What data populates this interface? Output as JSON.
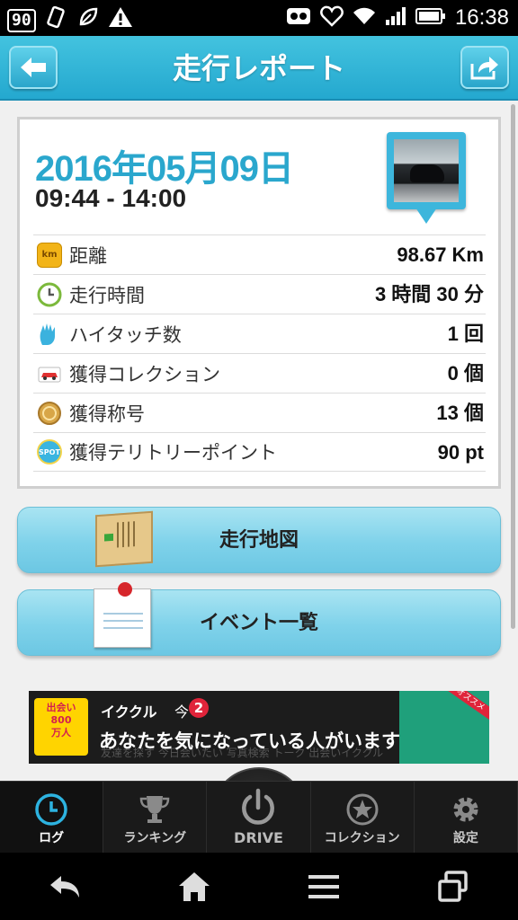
{
  "status_bar": {
    "battery_level": "90",
    "icons": [
      "sim-card-icon",
      "vibrate-icon",
      "leaf-icon",
      "warning-icon",
      "voicemail-icon",
      "heart-icon",
      "wifi-icon",
      "signal-icon",
      "battery-icon"
    ],
    "time": "16:38"
  },
  "header": {
    "title": "走行レポート",
    "back_icon": "back-arrow-icon",
    "share_icon": "share-icon"
  },
  "report": {
    "date": "2016年05月09日",
    "time_range": "09:44 - 14:00",
    "rows": [
      {
        "icon": "km-icon",
        "icon_text": "km",
        "label": "距離",
        "value": "98.67 Km"
      },
      {
        "icon": "clock-icon",
        "label": "走行時間",
        "value": "3 時間 30 分"
      },
      {
        "icon": "high-touch-icon",
        "label": "ハイタッチ数",
        "value": "1 回"
      },
      {
        "icon": "car-icon",
        "label": "獲得コレクション",
        "value": "0 個"
      },
      {
        "icon": "medal-icon",
        "label": "獲得称号",
        "value": "13 個"
      },
      {
        "icon": "spot-icon",
        "icon_text": "SPOT",
        "label": "獲得テリトリーポイント",
        "value": "90 pt"
      }
    ]
  },
  "actions": {
    "map_label": "走行地図",
    "events_label": "イベント一覧"
  },
  "ad": {
    "logo_text": "出会い\n800\n万人",
    "brand": "イククル",
    "today": "今",
    "count": "2",
    "headline": "あなたを気になっている人がいます",
    "background_labels": "友達を探す  今日会いたい  写真検索  トーク  出会いイククル",
    "ribbon": "オススメ"
  },
  "tabs": [
    {
      "label": "ログ",
      "icon": "log-clock-icon",
      "active": true
    },
    {
      "label": "ランキング",
      "icon": "trophy-icon",
      "active": false
    },
    {
      "label": "DRIVE",
      "icon": "power-icon",
      "active": false
    },
    {
      "label": "コレクション",
      "icon": "star-icon",
      "active": false
    },
    {
      "label": "設定",
      "icon": "gear-icon",
      "active": false
    }
  ],
  "colors": {
    "accent": "#2aa7cd",
    "header": "#35b6d8",
    "button": "#8ad6ec",
    "tab_bar": "#1a1a1a"
  }
}
